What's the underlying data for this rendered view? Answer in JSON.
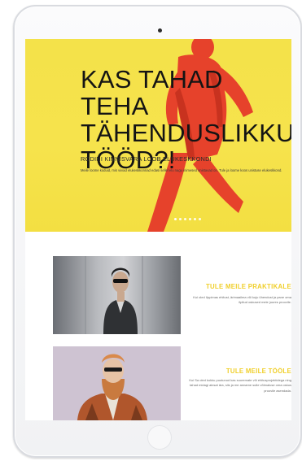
{
  "hero": {
    "title": "KAS TAHAD TEHA\nTÄHENDUSLIKKU\nTÖÖD?!",
    "subtitle": "RODINI KINNISVARA LOOB ELUKESKKONDI",
    "body": "Meile loome koduid, mis viivad elukeskkonnad edasi sellel elu nagu inimesed unistavad on. Tule ja loome koos unistuse elukeskkond.",
    "slide_count": 6,
    "active_slide": 1
  },
  "promos": [
    {
      "title": "TULE MEILE PRAKTIKALE",
      "text": "Kui oled õppimas ehitust, ärimaailma või kuju ühendust ja pane oma õpitud oskused meie juures proovile."
    },
    {
      "title": "TULE MEILE TÖÖLE",
      "text": "Kui Sa oled kokku puutunud kas suuremate või ehitusprojektidega ning tahad midagi ainsat ära, siis ja me anname sulle võimaluse oma oskus proovile asendada."
    }
  ],
  "colors": {
    "hero_yellow": "#f4e24a",
    "runner_red": "#e8432b",
    "promo_title": "#f0cf2a"
  },
  "icons": {
    "camera": "front-camera",
    "home": "home-button"
  }
}
